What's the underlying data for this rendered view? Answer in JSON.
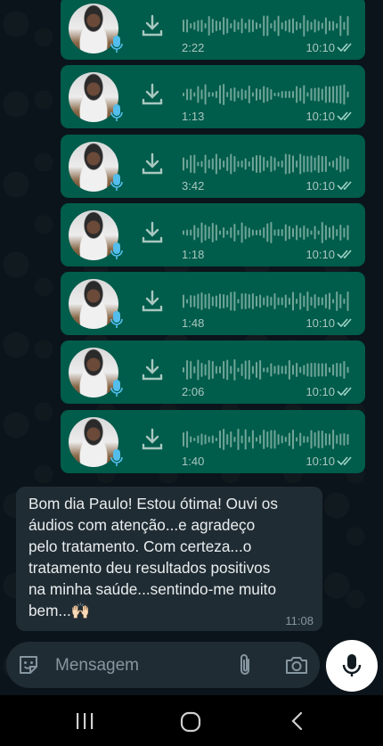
{
  "audio_messages": [
    {
      "duration": "2:22",
      "time": "10:10"
    },
    {
      "duration": "1:13",
      "time": "10:10"
    },
    {
      "duration": "3:42",
      "time": "10:10"
    },
    {
      "duration": "1:18",
      "time": "10:10"
    },
    {
      "duration": "1:48",
      "time": "10:10"
    },
    {
      "duration": "2:06",
      "time": "10:10"
    },
    {
      "duration": "1:40",
      "time": "10:10"
    }
  ],
  "incoming_message": {
    "text": "Bom dia Paulo! Estou ótima! Ouvi os\náudios com atenção...e agradeço\npelo tratamento. Com certeza...o\ntratamento deu resultados positivos\nna minha saúde...sentindo-me muito\nbem...🙌🏻",
    "time": "11:08"
  },
  "composer": {
    "placeholder": "Mensagem",
    "emoji_icon": "sticker-icon",
    "attach_icon": "paperclip-icon",
    "camera_icon": "camera-icon",
    "send_icon": "microphone-icon"
  },
  "colors": {
    "outgoing_bubble": "#005c4b",
    "incoming_bubble": "#202c33",
    "background": "#0b141a",
    "read_ticks": "#9fd4c6"
  }
}
